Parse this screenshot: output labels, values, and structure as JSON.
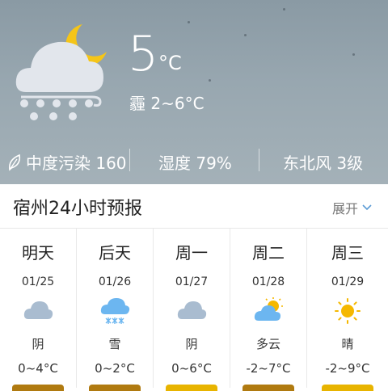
{
  "current": {
    "temperature": "5",
    "unit": "°C",
    "description": "霾 2~6°C",
    "icon": "cloud-moon-snow-icon"
  },
  "stats": {
    "pollution": "中度污染 160",
    "humidity": "湿度 79%",
    "wind": "东北风 3级"
  },
  "forecast": {
    "title": "宿州24小时预报",
    "expand_label": "展开",
    "days": [
      {
        "name": "明天",
        "date": "01/25",
        "condition": "阴",
        "range": "0~4°C",
        "icon": "cloud-icon",
        "bar_color": "#b07a10"
      },
      {
        "name": "后天",
        "date": "01/26",
        "condition": "雪",
        "range": "0~2°C",
        "icon": "snow-icon",
        "bar_color": "#b07a10"
      },
      {
        "name": "周一",
        "date": "01/27",
        "condition": "阴",
        "range": "0~6°C",
        "icon": "cloud-icon",
        "bar_color": "#e8b400"
      },
      {
        "name": "周二",
        "date": "01/28",
        "condition": "多云",
        "range": "-2~7°C",
        "icon": "partly-cloudy-icon",
        "bar_color": "#b07a10"
      },
      {
        "name": "周三",
        "date": "01/29",
        "condition": "晴",
        "range": "-2~9°C",
        "icon": "sun-icon",
        "bar_color": "#e8b400"
      }
    ]
  }
}
